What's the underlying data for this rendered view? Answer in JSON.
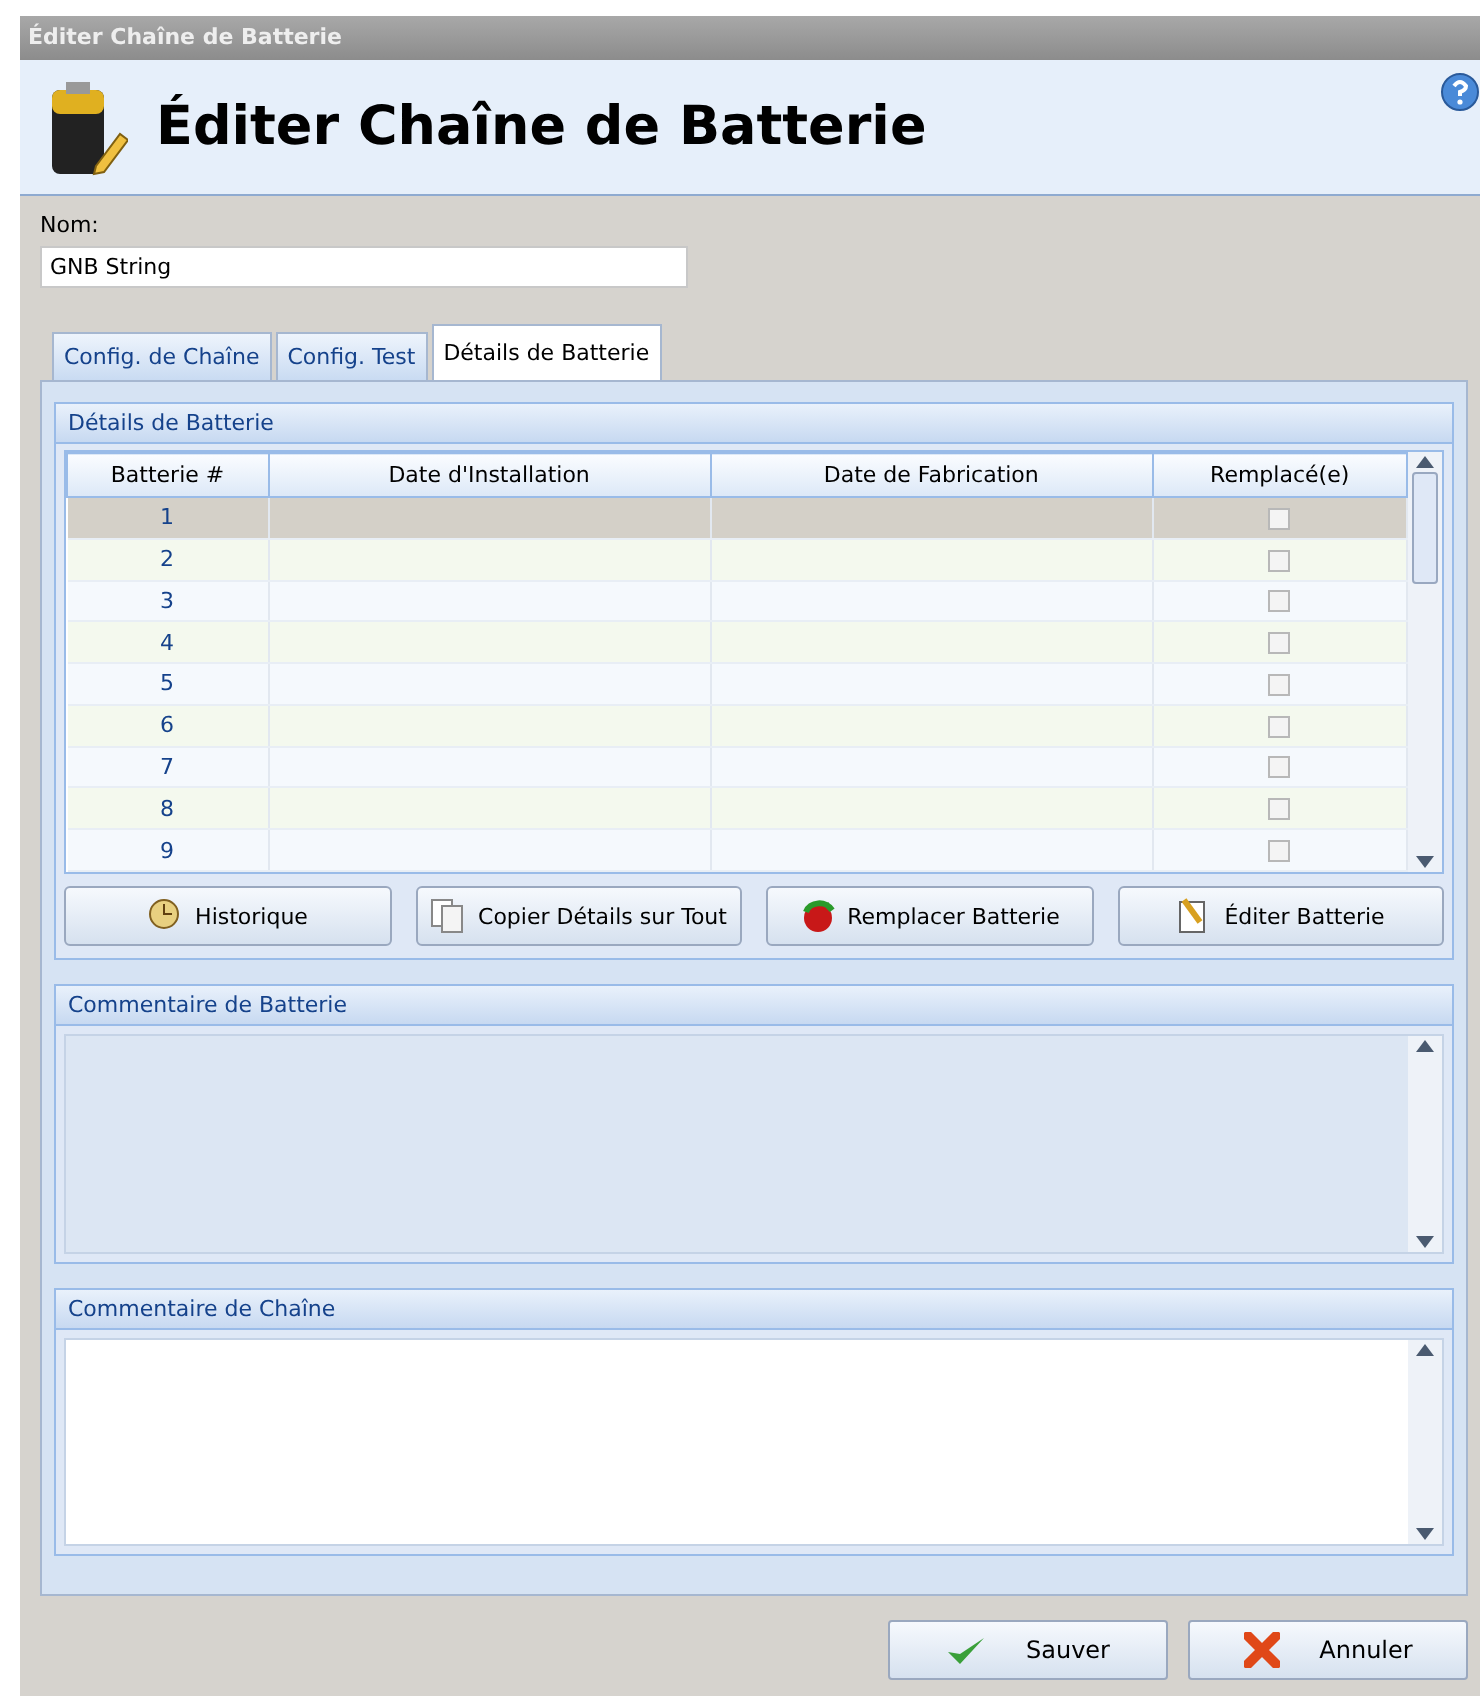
{
  "window": {
    "title": "Éditer Chaîne de Batterie"
  },
  "header": {
    "title": "Éditer Chaîne de Batterie"
  },
  "name_field": {
    "label": "Nom:",
    "value": "GNB String"
  },
  "tabs": [
    {
      "label": "Config. de Chaîne",
      "selected": false
    },
    {
      "label": "Config. Test",
      "selected": false
    },
    {
      "label": "Détails de Batterie",
      "selected": true
    }
  ],
  "details_group": {
    "title": "Détails de Batterie",
    "columns": [
      "Batterie #",
      "Date d'Installation",
      "Date de Fabrication",
      "Remplacé(e)"
    ],
    "rows": [
      {
        "number": "1",
        "selected": true,
        "checked": false
      },
      {
        "number": "2",
        "selected": false,
        "checked": false
      },
      {
        "number": "3",
        "selected": false,
        "checked": false
      },
      {
        "number": "4",
        "selected": false,
        "checked": false
      },
      {
        "number": "5",
        "selected": false,
        "checked": false
      },
      {
        "number": "6",
        "selected": false,
        "checked": false
      },
      {
        "number": "7",
        "selected": false,
        "checked": false
      },
      {
        "number": "8",
        "selected": false,
        "checked": false
      },
      {
        "number": "9",
        "selected": false,
        "checked": false
      }
    ],
    "buttons": [
      {
        "label": "Historique",
        "kind": "clock"
      },
      {
        "label": "Copier Détails sur Tout",
        "kind": "copy"
      },
      {
        "label": "Remplacer Batterie",
        "kind": "replace"
      },
      {
        "label": "Éditer Batterie",
        "kind": "edit"
      }
    ]
  },
  "battery_comment": {
    "title": "Commentaire de Batterie",
    "disabled": true
  },
  "string_comment": {
    "title": "Commentaire de Chaîne",
    "disabled": false
  },
  "footer_buttons": [
    {
      "label": "Sauver",
      "kind": "ok"
    },
    {
      "label": "Annuler",
      "kind": "cancel"
    }
  ]
}
